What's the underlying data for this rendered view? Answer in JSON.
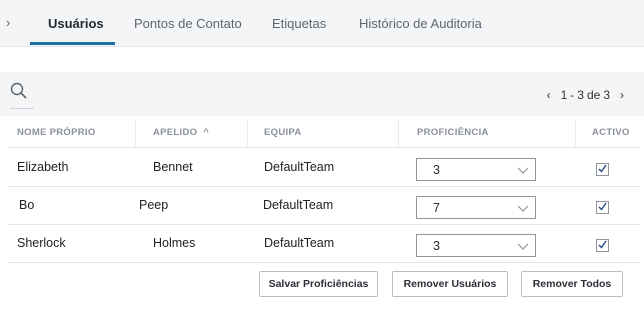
{
  "tabs": {
    "overflow_arrow": "›",
    "items": [
      {
        "label": "Usuários",
        "active": true
      },
      {
        "label": "Pontos de Contato",
        "active": false
      },
      {
        "label": "Etiquetas",
        "active": false
      },
      {
        "label": "Histórico de Auditoria",
        "active": false
      }
    ]
  },
  "pager": {
    "prev": "‹",
    "start": "1",
    "dash": "-",
    "end": "3",
    "of": "de",
    "total": "3",
    "next": "›"
  },
  "table": {
    "headers": {
      "first_name": "NOME PRÓPRIO",
      "last_name": "APELIDO",
      "sort_indicator": "^",
      "team": "EQUIPA",
      "proficiency": "PROFICIÊNCIA",
      "active": "ACTIVO"
    },
    "rows": [
      {
        "first_name": "Elizabeth",
        "last_name": "Bennet",
        "team": "DefaultTeam",
        "proficiency": "3",
        "active": true
      },
      {
        "first_name": "Bo",
        "last_name": "Peep",
        "team": "DefaultTeam",
        "proficiency": "7",
        "active": true
      },
      {
        "first_name": "Sherlock",
        "last_name": "Holmes",
        "team": "DefaultTeam",
        "proficiency": "3",
        "active": true
      }
    ]
  },
  "actions": {
    "save": "Salvar Proficiências",
    "remove_users": "Remover Usuários",
    "remove_all": "Remover Todos"
  },
  "colors": {
    "accent": "#1f6fa5",
    "toolbar_bg": "#f3f5f7"
  }
}
